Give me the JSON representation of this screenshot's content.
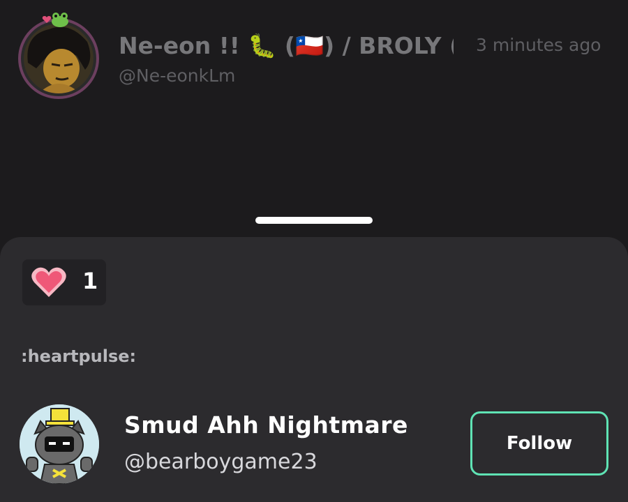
{
  "post": {
    "author_name": "Ne-eon !! 🐛 (🇨🇱) / BROLY (D",
    "author_handle": "@Ne-eonkLm",
    "timestamp": "3 minutes ago"
  },
  "reaction": {
    "icon": "heart-icon",
    "count": "1",
    "name": ":heartpulse:"
  },
  "reactor": {
    "display_name": "Smud Ahh Nightmare",
    "handle": "@bearboygame23",
    "follow_label": "Follow"
  },
  "colors": {
    "background": "#1c1b1d",
    "sheet": "#2c2b2e",
    "follow_border": "#5fe3b4",
    "heart": "#f0607e"
  }
}
